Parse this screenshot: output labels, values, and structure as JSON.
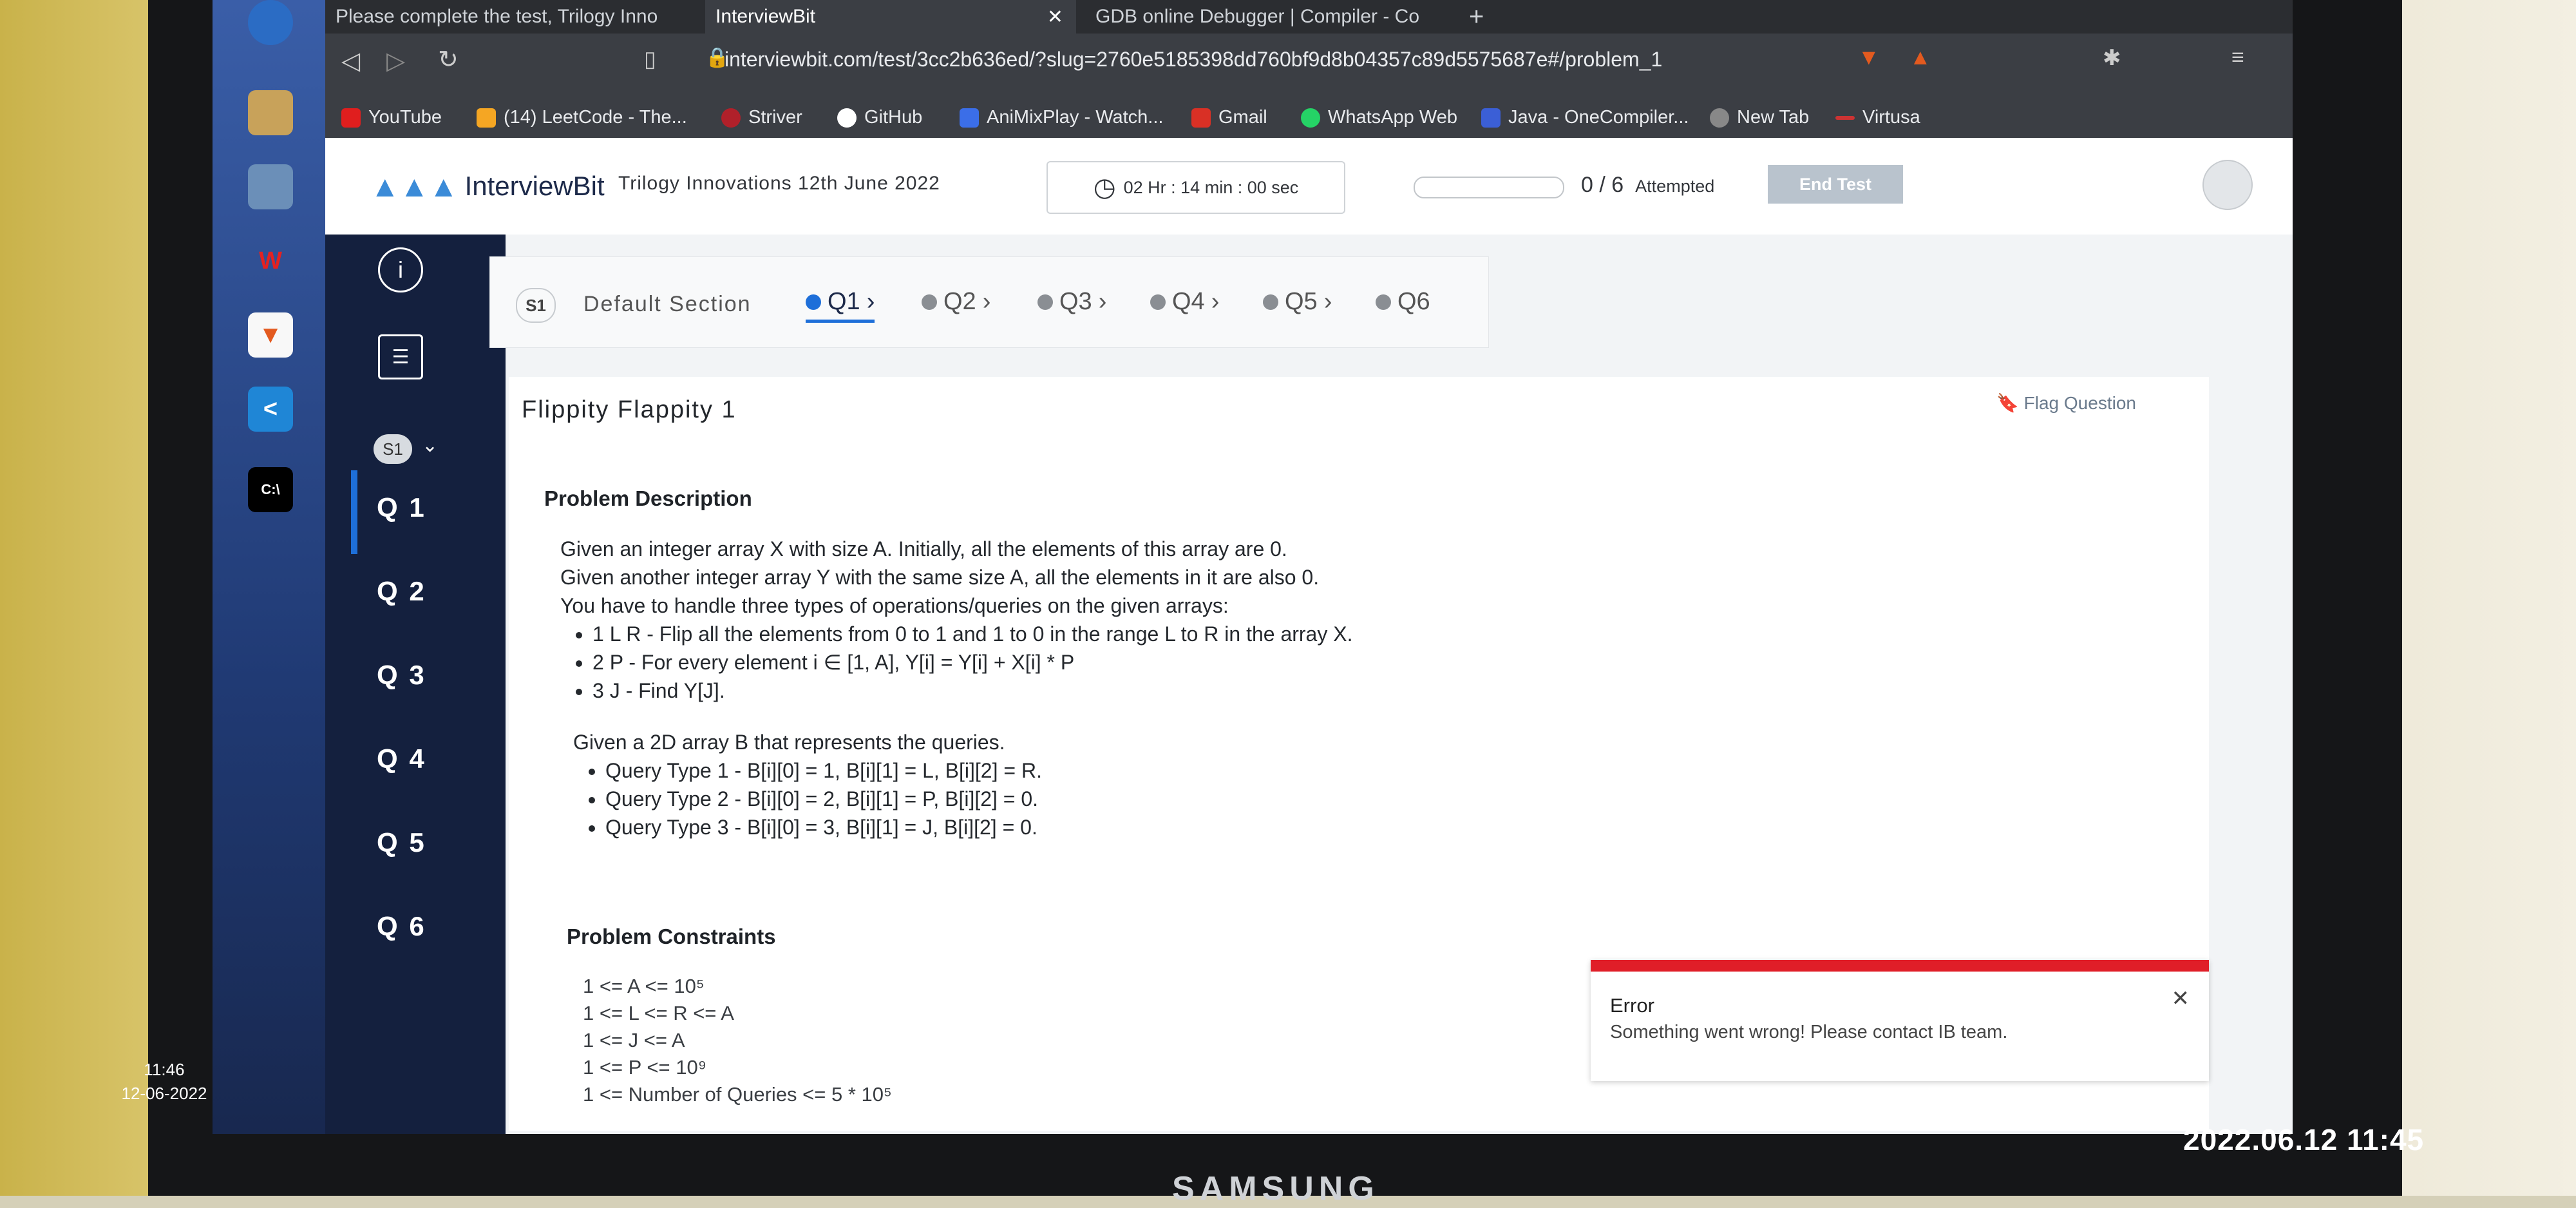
{
  "browser": {
    "tabs": [
      "Please complete the test, Trilogy Inno",
      "InterviewBit",
      "GDB online Debugger | Compiler - Co"
    ],
    "url": "interviewbit.com/test/3cc2b636ed/?slug=2760e5185398dd760bf9d8b04357c89d5575687e#/problem_1",
    "bookmarks": [
      "YouTube",
      "(14) LeetCode - The...",
      "Striver",
      "GitHub",
      "AniMixPlay - Watch...",
      "Gmail",
      "WhatsApp Web",
      "Java - OneCompiler...",
      "New Tab",
      "Virtusa"
    ]
  },
  "header": {
    "logo": "InterviewBit",
    "test_name": "Trilogy Innovations 12th June 2022",
    "timer": "02 Hr : 14 min : 00 sec",
    "attempted_count": "0 / 6",
    "attempted_label": "Attempted",
    "end_test": "End Test"
  },
  "sidebar": {
    "section": "S1",
    "questions": [
      "Q 1",
      "Q 2",
      "Q 3",
      "Q 4",
      "Q 5",
      "Q 6"
    ]
  },
  "question_tabs": {
    "section_badge": "S1",
    "section_name": "Default Section",
    "items": [
      "Q1",
      "Q2",
      "Q3",
      "Q4",
      "Q5",
      "Q6"
    ]
  },
  "problem": {
    "title": "Flippity Flappity 1",
    "flag": "Flag Question",
    "desc_heading": "Problem Description",
    "lines": [
      "Given an integer array X with size A. Initially, all the elements of this array are 0.",
      "Given another integer array Y with the same size A, all the elements in it are also 0.",
      "You have to handle three types of operations/queries on the given arrays:"
    ],
    "ops": [
      "1 L R - Flip all the elements from 0 to 1 and 1 to 0 in the range L to R in the array X.",
      "2 P - For every element i ∈ [1, A], Y[i] = Y[i] + X[i] * P",
      "3 J - Find Y[J]."
    ],
    "queries_intro": "Given a 2D array B that represents the queries.",
    "queries": [
      "Query Type 1 - B[i][0] = 1, B[i][1] = L, B[i][2] = R.",
      "Query Type 2 - B[i][0] = 2, B[i][1] = P, B[i][2] = 0.",
      "Query Type 3 - B[i][0] = 3, B[i][1] = J, B[i][2] = 0."
    ],
    "constraints_heading": "Problem Constraints",
    "constraints": [
      "1 <= A <= 10⁵",
      "1 <= L <= R <= A",
      "1 <= J <= A",
      "1 <= P <= 10⁹",
      "1 <= Number of Queries <= 5 * 10⁵"
    ]
  },
  "toast": {
    "title": "Error",
    "message": "Something went wrong! Please contact IB team."
  },
  "taskbar": {
    "time": "11:46",
    "date": "12-06-2022"
  },
  "monitor_brand": "SAMSUNG",
  "photo_stamp": "2022.06.12 11:45"
}
